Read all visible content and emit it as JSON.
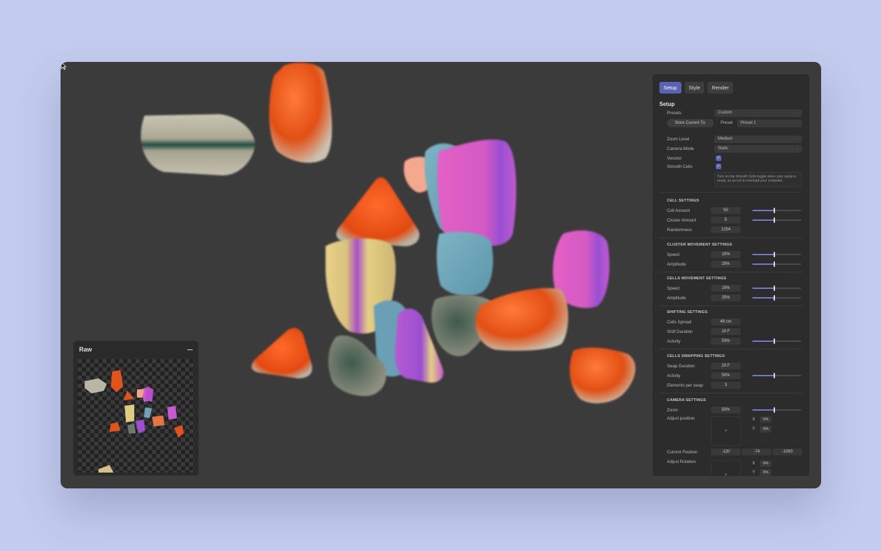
{
  "raw_panel": {
    "title": "Raw"
  },
  "tabs": [
    {
      "label": "Setup",
      "active": true
    },
    {
      "label": "Style",
      "active": false
    },
    {
      "label": "Render",
      "active": false
    }
  ],
  "panel_title": "Setup",
  "presets": {
    "label": "Presets",
    "value": "Custom"
  },
  "store": {
    "button_label": "Store Current To:",
    "preset_label": "Preset",
    "preset_value": "Preset 1"
  },
  "zoom_level": {
    "label": "Zoom Level",
    "value": "Medium"
  },
  "camera_mode": {
    "label": "Camera Mode",
    "value": "Static"
  },
  "voronoi": {
    "label": "Voronoi",
    "checked": true
  },
  "smooth_cells": {
    "label": "Smooth Cells",
    "checked": true,
    "help": "Turn on the Smooth Cells toggle when your setup is ready, so as not to overload your computer."
  },
  "cell_settings": {
    "title": "CELL SETTINGS",
    "cell_amount": {
      "label": "Cell Amount",
      "value": "50",
      "level": 0.45
    },
    "cluster_amount": {
      "label": "Cluster Amount",
      "value": "5",
      "level": 0.45
    },
    "randomness": {
      "label": "Randomness",
      "value": "1254"
    }
  },
  "cluster_movement": {
    "title": "CLUSTER MOVEMENT SETTINGS",
    "speed": {
      "label": "Speed",
      "value": "10%",
      "level": 0.45
    },
    "amplitude": {
      "label": "Amplitude",
      "value": "25%",
      "level": 0.45
    }
  },
  "cells_movement": {
    "title": "CELLS MOVEMENT SETTINGS",
    "speed": {
      "label": "Speed",
      "value": "10%",
      "level": 0.45
    },
    "amplitude": {
      "label": "Amplitude",
      "value": "25%",
      "level": 0.45
    }
  },
  "shifting": {
    "title": "SHIFTING SETTINGS",
    "cells_spread": {
      "label": "Cells Spread",
      "value": "49 cm"
    },
    "shift_duration": {
      "label": "Shift Duration",
      "value": "10 F"
    },
    "activity": {
      "label": "Activity",
      "value": "50%",
      "level": 0.45
    }
  },
  "swapping": {
    "title": "CELLS SWAPPING SETTINGS",
    "swap_duration": {
      "label": "Swap Duration",
      "value": "20 F"
    },
    "activity": {
      "label": "Activity",
      "value": "50%",
      "level": 0.45
    },
    "elements_per_swap": {
      "label": "Elements per swap",
      "value": "3"
    }
  },
  "camera": {
    "title": "CAMERA SETTINGS",
    "zoom": {
      "label": "Zoom",
      "value": "50%",
      "level": 0.45
    },
    "adjust_position": {
      "label": "Adjust position",
      "pad_symbol": "+",
      "x_label": "X",
      "x_value": "0%",
      "y_label": "Y",
      "y_value": "0%"
    },
    "current_position": {
      "label": "Current Position",
      "values": [
        "-120",
        "-74",
        "-1000"
      ]
    },
    "adjust_rotation": {
      "label": "Adjust Rotation",
      "pad_symbol": "+",
      "x_label": "X",
      "x_value": "0%",
      "y_label": "Y",
      "y_value": "0%"
    }
  },
  "colors": {
    "accent": "#5a63b3",
    "orange": "#e4551d",
    "magenta": "#c35ad0",
    "teal": "#6fa3b8",
    "cream": "#e2cf87",
    "gray": "#8d8f7f",
    "background": "#c3cbee"
  }
}
